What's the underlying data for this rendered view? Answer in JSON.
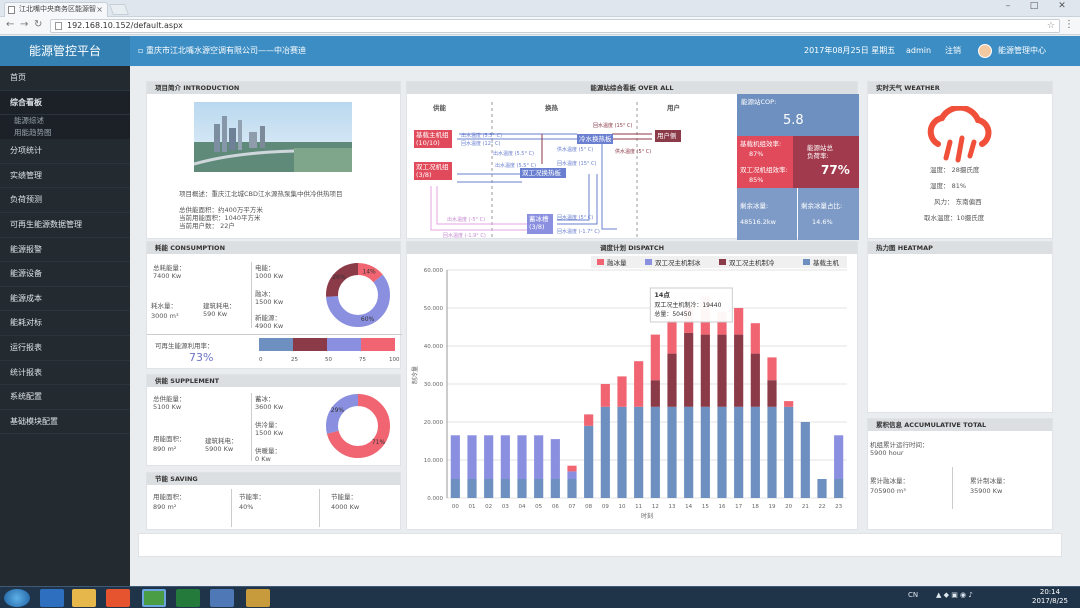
{
  "browser": {
    "tab_title": "江北嘴中央商务区能源智",
    "url": "192.168.10.152/default.aspx"
  },
  "header": {
    "brand": "能源管控平台",
    "company": "重庆市江北嘴水源空调有限公司——中冶赛迪",
    "date": "2017年08月25日 星期五",
    "user": "admin",
    "logout": "注销",
    "center": "能源管理中心"
  },
  "sidebar": {
    "items": [
      "首页",
      "综合看板",
      "分项统计",
      "实绩管理",
      "负荷预测",
      "可再生能源数据管理",
      "能源报警",
      "能源设备",
      "能源成本",
      "能耗对标",
      "运行报表",
      "统计报表",
      "系统配置",
      "基础模块配置"
    ],
    "subitems": [
      "能源综述",
      "用能趋势图"
    ]
  },
  "intro": {
    "title": "项目简介 INTRODUCTION",
    "overview": "项目概述：重庆江北城CBD江水源热泵集中供冷供热项目",
    "supply_area": "总供能面积：约400万平方米",
    "current_area": "当前用能面积：1040平方米",
    "current_users": "当前用户数：   22户"
  },
  "overall": {
    "title": "能源站综合看板 OVER ALL",
    "col_supply": "供能",
    "col_exchange": "换热",
    "col_user": "用户",
    "boxes": {
      "base": "基载主机组",
      "base_sub": "(10/10)",
      "dual": "双工况机组",
      "dual_sub": "(3/8)",
      "hx": "冷水换热板",
      "hx2": "双工况换热板",
      "tank": "蓄冰槽",
      "tank_sub": "(3/8)",
      "user": "用户侧"
    },
    "flows": {
      "f1": "回水温度 (15° C)",
      "f2": "出水温度 (5.5° C)",
      "f3": "供水温度 (5° C)",
      "f4": "回水温度 (12° C)",
      "f5": "出水温度 (5.5° C)",
      "f6": "回水温度 (15° C)",
      "f7": "出水温度 (5.5° C)",
      "f8": "供水温度 (5° C)",
      "f9": "出水温度 (-5° C)",
      "f10": "回水温度 (-1.9° C)",
      "f11": "回水温度 (5° C)",
      "f12": "回水温度 (-1.7° C)"
    },
    "stats": {
      "cop_label": "能源站COP:",
      "cop": "5.8",
      "base_eff_label": "基载机组效率:",
      "base_eff": "87%",
      "load_label": "能源站总负荷率:",
      "load": "77%",
      "dual_eff_label": "双工况机组效率:",
      "dual_eff": "85%",
      "ice_label": "剩余冰量:",
      "ice": "48516.2kw",
      "ice_ratio_label": "剩余冰量占比:",
      "ice_ratio": "14.6%"
    }
  },
  "weather": {
    "title": "实时天气 WEATHER",
    "temp": "温度：   28摄氏度",
    "humidity": "湿度：   81%",
    "wind": "风力：   东南偏西",
    "water_temp": "取水温度：10摄氏度"
  },
  "consumption": {
    "title": "耗能 CONSUMPTION",
    "total_label": "总耗能量：",
    "total": "7400 Kw",
    "elec_label": "电能：",
    "elec": "1000 Kw",
    "water_label": "耗水量：",
    "water": "3000 m³",
    "bld_label": "建筑耗电：",
    "bld": "590 Kw",
    "ice_label": "融冰：",
    "ice": "1500 Kw",
    "new_label": "新能源：",
    "new": "4900 Kw",
    "renew_label": "可再生能源利用率：",
    "renew": "73%",
    "donut": [
      {
        "label": "14%",
        "value": 14,
        "color": "#f06571"
      },
      {
        "label": "60%",
        "value": 60,
        "color": "#8a8fe0"
      },
      {
        "label": "26%",
        "value": 26,
        "color": "#8b3a48"
      }
    ],
    "bar_ticks": [
      "0",
      "25",
      "50",
      "75",
      "100"
    ]
  },
  "supplement": {
    "title": "供能 SUPPLEMENT",
    "total_label": "总供能量：",
    "total": "5100 Kw",
    "ice_label": "蓄冰：",
    "ice": "3600 Kw",
    "area_label": "用能面积：",
    "area": "890 m²",
    "bld_label": "建筑耗电：",
    "bld": "5900 Kw",
    "cool_label": "供冷量：",
    "cool": "1500 Kw",
    "heat_label": "供暖量：",
    "heat": "0 Kw",
    "donut": [
      {
        "label": "71%",
        "value": 71,
        "color": "#f06571"
      },
      {
        "label": "29%",
        "value": 29,
        "color": "#8a8fe0"
      },
      {
        "label": "0%",
        "value": 0,
        "color": "#8b3a48"
      }
    ]
  },
  "saving": {
    "title": "节能 SAVING",
    "area_label": "用能面积：",
    "area": "890 m²",
    "rate_label": "节能率：",
    "rate": "40%",
    "energy_label": "节能量：",
    "energy": "4000 Kw"
  },
  "heatmap": {
    "title": "热力图 HEATMAP"
  },
  "accumulative": {
    "title": "累积信息 ACCUMULATIVE TOTAL",
    "run_label": "机组累计运行时间：",
    "run": "5900 hour",
    "ice_label": "累计融冰量：",
    "ice": "705900 m³",
    "cool_label": "累计制冰量：",
    "cool": "35900 Kw"
  },
  "chart_data": {
    "type": "bar",
    "title": "调度计划 DISPATCH",
    "xlabel": "时刻",
    "ylabel": "制冷量",
    "ylim": [
      0,
      60000
    ],
    "yticks": [
      "0.000",
      "10.000",
      "20.000",
      "30.000",
      "40.000",
      "50.000",
      "60.000"
    ],
    "categories": [
      "00",
      "01",
      "02",
      "03",
      "04",
      "05",
      "06",
      "07",
      "08",
      "09",
      "10",
      "11",
      "12",
      "13",
      "14",
      "15",
      "16",
      "17",
      "18",
      "19",
      "20",
      "21",
      "22",
      "23"
    ],
    "series": [
      {
        "name": "基载主机",
        "color": "#6e90c0",
        "values": [
          5000,
          5000,
          5000,
          5000,
          5000,
          5000,
          5000,
          5000,
          19000,
          24000,
          24000,
          24000,
          24000,
          24000,
          24000,
          24000,
          24000,
          24000,
          24000,
          24000,
          24000,
          20000,
          5000,
          5000
        ]
      },
      {
        "name": "双工况主机制冷",
        "color": "#8b3a48",
        "values": [
          0,
          0,
          0,
          0,
          0,
          0,
          0,
          0,
          0,
          0,
          0,
          0,
          7000,
          14000,
          19440,
          19000,
          19000,
          19000,
          14000,
          7000,
          0,
          0,
          0,
          0
        ]
      },
      {
        "name": "双工况主机制冰",
        "color": "#8a8fe0",
        "values": [
          11500,
          11500,
          11500,
          11500,
          11500,
          11500,
          10500,
          2000,
          0,
          0,
          0,
          0,
          0,
          0,
          0,
          0,
          0,
          0,
          0,
          0,
          0,
          0,
          0,
          11500
        ]
      },
      {
        "name": "融冰量",
        "color": "#f06571",
        "values": [
          0,
          0,
          0,
          0,
          0,
          0,
          0,
          1500,
          3000,
          6000,
          8000,
          12000,
          12000,
          9000,
          7010,
          10000,
          6000,
          7000,
          8000,
          6000,
          1500,
          0,
          0,
          0
        ]
      }
    ],
    "legend": "top-right",
    "tooltip": {
      "title": "14点",
      "line1": "双工况主机制冷：19440",
      "line2": "总量：50450"
    }
  }
}
